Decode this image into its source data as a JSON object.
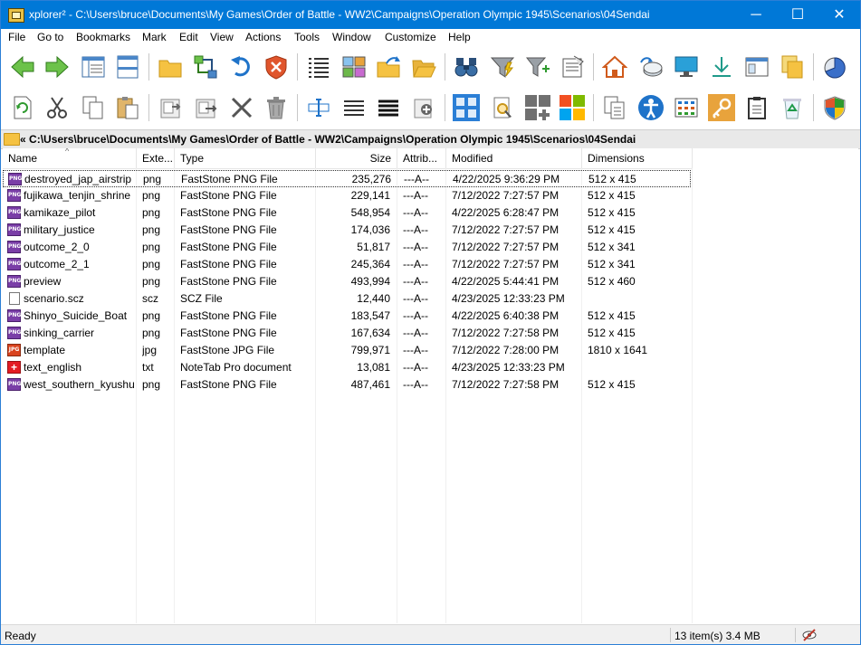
{
  "window": {
    "title": "xplorer² - C:\\Users\\bruce\\Documents\\My Games\\Order of Battle - WW2\\Campaigns\\Operation Olympic 1945\\Scenarios\\04Sendai",
    "minimize": "─",
    "maximize": "☐",
    "close": "✕"
  },
  "menu": [
    "File",
    "Go to",
    "Bookmarks",
    "Mark",
    "Edit",
    "View",
    "Actions",
    "Tools",
    "Window",
    "Customize",
    "Help"
  ],
  "address": {
    "prefix": "«",
    "path": "C:\\Users\\bruce\\Documents\\My Games\\Order of Battle - WW2\\Campaigns\\Operation Olympic 1945\\Scenarios\\04Sendai"
  },
  "columns": {
    "name": "Name",
    "ext": "Exte...",
    "type": "Type",
    "size": "Size",
    "attrib": "Attrib...",
    "modified": "Modified",
    "dimensions": "Dimensions"
  },
  "sort_indicator": "^",
  "files": [
    {
      "name": "destroyed_jap_airstrip",
      "ext": "png",
      "type": "FastStone PNG File",
      "size": "235,276",
      "attrib": "---A--",
      "modified": "4/22/2025 9:36:29 PM",
      "dimensions": "512 x 415",
      "icon": "png"
    },
    {
      "name": "fujikawa_tenjin_shrine",
      "ext": "png",
      "type": "FastStone PNG File",
      "size": "229,141",
      "attrib": "---A--",
      "modified": "7/12/2022 7:27:57 PM",
      "dimensions": "512 x 415",
      "icon": "png"
    },
    {
      "name": "kamikaze_pilot",
      "ext": "png",
      "type": "FastStone PNG File",
      "size": "548,954",
      "attrib": "---A--",
      "modified": "4/22/2025 6:28:47 PM",
      "dimensions": "512 x 415",
      "icon": "png"
    },
    {
      "name": "military_justice",
      "ext": "png",
      "type": "FastStone PNG File",
      "size": "174,036",
      "attrib": "---A--",
      "modified": "7/12/2022 7:27:57 PM",
      "dimensions": "512 x 415",
      "icon": "png"
    },
    {
      "name": "outcome_2_0",
      "ext": "png",
      "type": "FastStone PNG File",
      "size": "51,817",
      "attrib": "---A--",
      "modified": "7/12/2022 7:27:57 PM",
      "dimensions": "512 x 341",
      "icon": "png"
    },
    {
      "name": "outcome_2_1",
      "ext": "png",
      "type": "FastStone PNG File",
      "size": "245,364",
      "attrib": "---A--",
      "modified": "7/12/2022 7:27:57 PM",
      "dimensions": "512 x 341",
      "icon": "png"
    },
    {
      "name": "preview",
      "ext": "png",
      "type": "FastStone PNG File",
      "size": "493,994",
      "attrib": "---A--",
      "modified": "4/22/2025 5:44:41 PM",
      "dimensions": "512 x 460",
      "icon": "png"
    },
    {
      "name": "scenario.scz",
      "ext": "scz",
      "type": "SCZ File",
      "size": "12,440",
      "attrib": "---A--",
      "modified": "4/23/2025 12:33:23 PM",
      "dimensions": "",
      "icon": "doc"
    },
    {
      "name": "Shinyo_Suicide_Boat",
      "ext": "png",
      "type": "FastStone PNG File",
      "size": "183,547",
      "attrib": "---A--",
      "modified": "4/22/2025 6:40:38 PM",
      "dimensions": "512 x 415",
      "icon": "png"
    },
    {
      "name": "sinking_carrier",
      "ext": "png",
      "type": "FastStone PNG File",
      "size": "167,634",
      "attrib": "---A--",
      "modified": "7/12/2022 7:27:58 PM",
      "dimensions": "512 x 415",
      "icon": "png"
    },
    {
      "name": "template",
      "ext": "jpg",
      "type": "FastStone JPG File",
      "size": "799,971",
      "attrib": "---A--",
      "modified": "7/12/2022 7:28:00 PM",
      "dimensions": "1810 x 1641",
      "icon": "jpg"
    },
    {
      "name": "text_english",
      "ext": "txt",
      "type": "NoteTab Pro document",
      "size": "13,081",
      "attrib": "---A--",
      "modified": "4/23/2025 12:33:23 PM",
      "dimensions": "",
      "icon": "txt"
    },
    {
      "name": "west_southern_kyushu",
      "ext": "png",
      "type": "FastStone PNG File",
      "size": "487,461",
      "attrib": "---A--",
      "modified": "7/12/2022 7:27:58 PM",
      "dimensions": "512 x 415",
      "icon": "png"
    }
  ],
  "file_icon_labels": {
    "png": "PNG",
    "jpg": "JPG",
    "txt": "+"
  },
  "status": {
    "left": "Ready",
    "right": "13 item(s) 3.4 MB"
  },
  "toolbar_row1": [
    "back-icon",
    "forward-icon",
    "details-pane-icon",
    "dual-pane-icon",
    "new-folder-icon",
    "sync-folders-icon",
    "undo-icon",
    "delete-shield-icon",
    "list-view-icon",
    "thumbnails-icon",
    "move-to-icon",
    "open-folder-icon",
    "find-binoculars-icon",
    "filter-icon",
    "add-filter-icon",
    "properties-icon",
    "home-icon",
    "map-drive-icon",
    "desktop-icon",
    "download-icon",
    "window-icon",
    "stacked-folders-icon",
    "pie-chart-icon"
  ],
  "toolbar_row2": [
    "refresh-icon",
    "cut-icon",
    "copy-icon",
    "paste-icon",
    "copy-to-icon",
    "move-to-icon",
    "delete-x-icon",
    "recycle-bin-icon",
    "rename-icon",
    "menu-lines-icon",
    "bold-lines-icon",
    "new-file-icon",
    "grid-view-icon",
    "search-doc-icon",
    "gray-tiles-icon",
    "colored-tiles-icon",
    "copy-path-icon",
    "accessibility-icon",
    "browse-grid-icon",
    "key-icon",
    "clipboard-icon",
    "recycle-icon",
    "security-shield-icon"
  ]
}
